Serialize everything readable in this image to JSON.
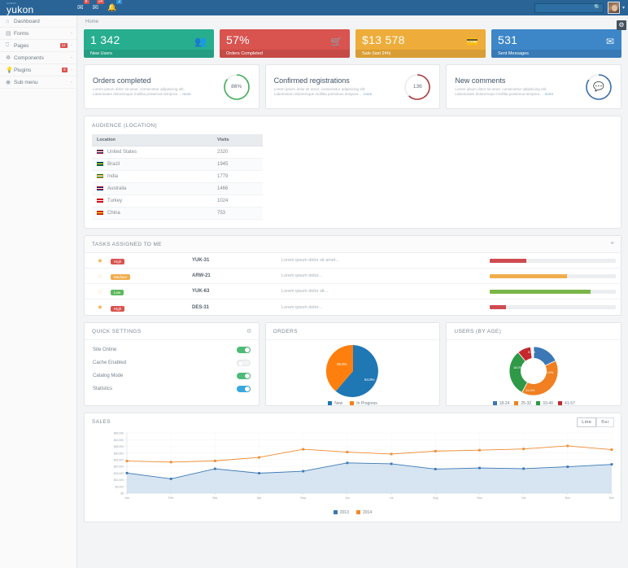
{
  "header": {
    "brand_sub": "ADMIN",
    "brand": "yukon",
    "icons": [
      {
        "name": "envelope-icon",
        "glyph": "✉",
        "badge": "8",
        "badge_color": "#d9534f"
      },
      {
        "name": "inbox-icon",
        "glyph": "✉",
        "badge": "14",
        "badge_color": "#d9534f"
      },
      {
        "name": "bell-icon",
        "glyph": "ὑ4",
        "badge": "2",
        "badge_color": "#2e8ece"
      }
    ],
    "search_placeholder": "",
    "search_value": "",
    "search_icon": "search-icon",
    "avatar_caret": "▾",
    "settings_gear": "⚙"
  },
  "sidebar": {
    "items": [
      {
        "label": "Dashboard",
        "icon": "⌂",
        "badge": "",
        "caret": ""
      },
      {
        "label": "Forms",
        "icon": "▤",
        "badge": "",
        "caret": "-"
      },
      {
        "label": "Pages",
        "icon": "◱",
        "badge": "12",
        "caret": "-"
      },
      {
        "label": "Components",
        "icon": "☸",
        "badge": "",
        "caret": "-"
      },
      {
        "label": "Plugins",
        "icon": "⚙",
        "badge": "9",
        "caret": "-"
      },
      {
        "label": "Sub menu",
        "icon": "☉",
        "badge": "",
        "caret": "-"
      }
    ]
  },
  "breadcrumb": "Home",
  "stats": [
    {
      "value": "1 342",
      "label": "New Users",
      "icon": "὆5",
      "color": "#27ae8f",
      "icon_name": "users-icon"
    },
    {
      "value": "57%",
      "label": "Orders Completed",
      "icon": "Ὥ2",
      "color": "#d9534f",
      "icon_name": "cart-icon"
    },
    {
      "value": "$13 578",
      "label": "Sale (last 24h)",
      "icon": "Ὃ3",
      "color": "#eead3a",
      "icon_name": "wallet-icon"
    },
    {
      "value": "531",
      "label": "Sent Messages",
      "icon": "✉",
      "color": "#3d87c8",
      "icon_name": "mail-icon"
    }
  ],
  "infocards": [
    {
      "title": "Orders completed",
      "desc_line1": "Lorem ipsum dolor sit amet, consectetur adipisicing elit.",
      "desc_line2": "Laboriosam doloremque mollitia possimus tempora ...",
      "more": "more",
      "ring_value": "86%",
      "ring_color": "#3fae5a",
      "ring_percent": 86,
      "icon": ""
    },
    {
      "title": "Confirmed registrations",
      "desc_line1": "Lorem ipsum dolor sit amet, consectetur adipisicing elit.",
      "desc_line2": "Laboriosam doloremque mollitia possimus tempora ...",
      "more": "more",
      "ring_value": "136",
      "ring_color": "#a93d3d",
      "ring_percent": 62,
      "icon": ""
    },
    {
      "title": "New comments",
      "desc_line1": "Lorem ipsum dolor sit amet, consectetur adipisicing elit.",
      "desc_line2": "Laboriosam doloremque mollitia possimus tempora ...",
      "more": "more",
      "ring_value": "",
      "ring_color": "#3b6fa8",
      "ring_percent": 85,
      "icon": "ὊC"
    }
  ],
  "audience": {
    "title": "AUDIENCE (LOCATION)",
    "columns": [
      "Location",
      "Visits"
    ],
    "rows": [
      {
        "country": "United States",
        "visits": "2320",
        "flag_name": "flag-us",
        "c1": "#b22234",
        "c2": "#ffffff",
        "c3": "#3c3b6e"
      },
      {
        "country": "Brazil",
        "visits": "1945",
        "flag_name": "flag-br",
        "c1": "#009c3b",
        "c2": "#ffdf00",
        "c3": "#002776"
      },
      {
        "country": "India",
        "visits": "1779",
        "flag_name": "flag-in",
        "c1": "#ff9933",
        "c2": "#ffffff",
        "c3": "#138808"
      },
      {
        "country": "Australia",
        "visits": "1466",
        "flag_name": "flag-au",
        "c1": "#00247d",
        "c2": "#ffffff",
        "c3": "#cf142b"
      },
      {
        "country": "Turkey",
        "visits": "1024",
        "flag_name": "flag-tr",
        "c1": "#e30a17",
        "c2": "#ffffff",
        "c3": "#e30a17"
      },
      {
        "country": "China",
        "visits": "753",
        "flag_name": "flag-cn",
        "c1": "#de2910",
        "c2": "#ffde00",
        "c3": "#de2910"
      }
    ]
  },
  "tasks": {
    "title": "TASKS ASSIGNED TO ME",
    "header_icon": "≡",
    "rows": [
      {
        "starred": true,
        "priority": "High",
        "priority_class": "p-high",
        "code": "YUK-31",
        "desc": "Lorem ipsum dolor sit amet...",
        "progress": 29,
        "bar_color": "#cf4b52"
      },
      {
        "starred": false,
        "priority": "Medium",
        "priority_class": "p-med",
        "code": "ARW-21",
        "desc": "Lorem ipsum dolor...",
        "progress": 61,
        "bar_color": "#f0ad4e"
      },
      {
        "starred": false,
        "priority": "Low",
        "priority_class": "p-low",
        "code": "YUK-63",
        "desc": "Lorem ipsum dolor sit...",
        "progress": 80,
        "bar_color": "#7ab648"
      },
      {
        "starred": true,
        "priority": "High",
        "priority_class": "p-high",
        "code": "DES-31",
        "desc": "Lorem ipsum dolor...",
        "progress": 13,
        "bar_color": "#cf4b52"
      }
    ]
  },
  "quick_settings": {
    "title": "QUICK SETTINGS",
    "gear_icon": "⚙",
    "rows": [
      {
        "label": "Site Online",
        "state": "on",
        "style": "green"
      },
      {
        "label": "Cache Enabled",
        "state": "off",
        "style": "off"
      },
      {
        "label": "Catalog Mode",
        "state": "on",
        "style": "green"
      },
      {
        "label": "Statistics",
        "state": "on",
        "style": "blue"
      }
    ]
  },
  "orders_panel": {
    "title": "ORDERS"
  },
  "users_panel": {
    "title": "USERS (BY AGE)"
  },
  "sales_panel": {
    "title": "SALES",
    "btn_line": "Line",
    "btn_bar": "Bar"
  },
  "chart_data": [
    {
      "type": "pie",
      "title": "ORDERS",
      "labels": [
        "New",
        "In Progress"
      ],
      "values": [
        64.9,
        35.0
      ],
      "value_labels": [
        "64.9%",
        "35.0%"
      ],
      "colors": [
        "#1f77b4",
        "#ff7f0e"
      ],
      "legend": "bottom"
    },
    {
      "type": "pie",
      "title": "USERS (BY AGE)",
      "donut": true,
      "labels": [
        "18-24",
        "25-32",
        "33-40",
        "41-57"
      ],
      "values": [
        18.0,
        40.0,
        31.0,
        9.0
      ],
      "value_labels": [
        "18.0%",
        "40.0%",
        "31.0%",
        "9.0%"
      ],
      "colors": [
        "#3b78b5",
        "#f08021",
        "#2e9947",
        "#c5272d"
      ],
      "legend": "bottom"
    },
    {
      "type": "line",
      "title": "SALES",
      "x": [
        "Jan",
        "Feb",
        "Mar",
        "Apr",
        "May",
        "Jun",
        "Jul",
        "Aug",
        "Sep",
        "Oct",
        "Nov",
        "Dec"
      ],
      "ylim": [
        0,
        45000
      ],
      "ytick_labels": [
        "$0",
        "$5,000",
        "$10,000",
        "$15,000",
        "$20,000",
        "$25,000",
        "$30,000",
        "$35,000",
        "$40,000",
        "$45,000"
      ],
      "ytick_values": [
        0,
        5000,
        10000,
        15000,
        20000,
        25000,
        30000,
        35000,
        40000,
        45000
      ],
      "xlabel": "",
      "ylabel": "",
      "grid": true,
      "legend": "bottom",
      "series": [
        {
          "name": "2013",
          "color": "#3b78b5",
          "fill": "#cfe0ee",
          "values": [
            15000,
            10700,
            18200,
            14900,
            16400,
            22600,
            21900,
            18000,
            18800,
            18300,
            19700,
            21500
          ]
        },
        {
          "name": "2014",
          "color": "#ef8a2e",
          "fill": "none",
          "values": [
            24000,
            23200,
            24100,
            26700,
            32800,
            30700,
            29200,
            31400,
            32100,
            33000,
            35300,
            32500
          ]
        }
      ]
    }
  ]
}
